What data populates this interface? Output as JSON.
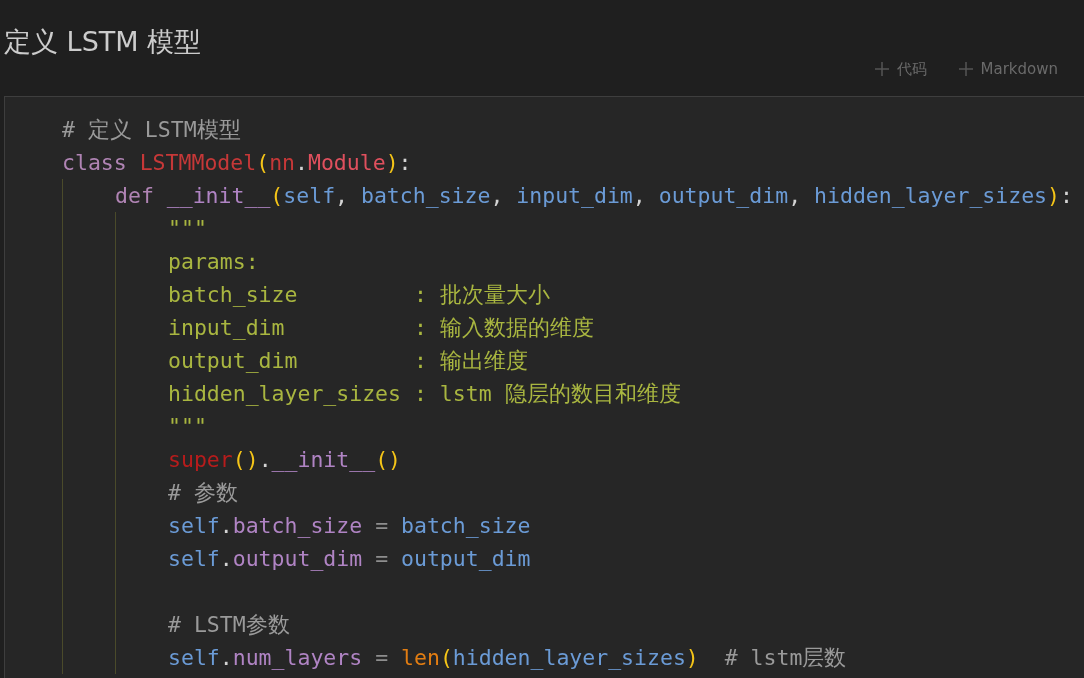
{
  "heading": "定义 LSTM 模型",
  "toolbar": [
    {
      "label": "代码"
    },
    {
      "label": "Markdown"
    }
  ],
  "code": [
    {
      "kind": "code",
      "tokens": [
        {
          "kind": "comment",
          "text": "# 定义 LSTM模型"
        }
      ]
    },
    {
      "kind": "code",
      "tokens": [
        {
          "kind": "keyword",
          "text": "class "
        },
        {
          "kind": "classname",
          "text": "LSTMModel"
        },
        {
          "kind": "paren",
          "text": "("
        },
        {
          "kind": "classname",
          "text": "nn"
        },
        {
          "kind": "plain",
          "text": "."
        },
        {
          "kind": "type",
          "text": "Module"
        },
        {
          "kind": "paren",
          "text": ")"
        },
        {
          "kind": "plain",
          "text": ":"
        }
      ],
      "children": [
        {
          "kind": "code",
          "tokens": [
            {
              "kind": "keyword",
              "text": "def "
            },
            {
              "kind": "dunder",
              "text": "__init__"
            },
            {
              "kind": "paren",
              "text": "("
            },
            {
              "kind": "param",
              "text": "self"
            },
            {
              "kind": "plain",
              "text": ", "
            },
            {
              "kind": "param",
              "text": "batch_size"
            },
            {
              "kind": "plain",
              "text": ", "
            },
            {
              "kind": "param",
              "text": "input_dim"
            },
            {
              "kind": "plain",
              "text": ", "
            },
            {
              "kind": "param",
              "text": "output_dim"
            },
            {
              "kind": "plain",
              "text": ", "
            },
            {
              "kind": "param",
              "text": "hidden_layer_sizes"
            },
            {
              "kind": "paren",
              "text": ")"
            },
            {
              "kind": "plain",
              "text": ":"
            }
          ],
          "children": [
            {
              "kind": "code",
              "tokens": [
                {
                  "kind": "string",
                  "text": "\"\"\""
                }
              ]
            },
            {
              "kind": "code",
              "tokens": [
                {
                  "kind": "string",
                  "text": "params:"
                }
              ]
            },
            {
              "kind": "code",
              "tokens": [
                {
                  "kind": "string",
                  "text": "batch_size         : 批次量大小"
                }
              ]
            },
            {
              "kind": "code",
              "tokens": [
                {
                  "kind": "string",
                  "text": "input_dim          : 输入数据的维度"
                }
              ]
            },
            {
              "kind": "code",
              "tokens": [
                {
                  "kind": "string",
                  "text": "output_dim         : 输出维度"
                }
              ]
            },
            {
              "kind": "code",
              "tokens": [
                {
                  "kind": "string",
                  "text": "hidden_layer_sizes : lstm 隐层的数目和维度"
                }
              ]
            },
            {
              "kind": "code",
              "tokens": [
                {
                  "kind": "string",
                  "text": "\"\"\""
                }
              ]
            },
            {
              "kind": "code",
              "tokens": [
                {
                  "kind": "builtin",
                  "text": "super"
                },
                {
                  "kind": "paren",
                  "text": "()"
                },
                {
                  "kind": "plain",
                  "text": "."
                },
                {
                  "kind": "dunder",
                  "text": "__init__"
                },
                {
                  "kind": "paren",
                  "text": "()"
                }
              ]
            },
            {
              "kind": "code",
              "tokens": [
                {
                  "kind": "comment",
                  "text": "# 参数"
                }
              ]
            },
            {
              "kind": "code",
              "tokens": [
                {
                  "kind": "param",
                  "text": "self"
                },
                {
                  "kind": "plain",
                  "text": "."
                },
                {
                  "kind": "property",
                  "text": "batch_size"
                },
                {
                  "kind": "operator",
                  "text": " = "
                },
                {
                  "kind": "param",
                  "text": "batch_size"
                }
              ]
            },
            {
              "kind": "code",
              "tokens": [
                {
                  "kind": "param",
                  "text": "self"
                },
                {
                  "kind": "plain",
                  "text": "."
                },
                {
                  "kind": "property",
                  "text": "output_dim"
                },
                {
                  "kind": "operator",
                  "text": " = "
                },
                {
                  "kind": "param",
                  "text": "output_dim"
                }
              ]
            },
            {
              "kind": "blank"
            },
            {
              "kind": "code",
              "tokens": [
                {
                  "kind": "comment",
                  "text": "# LSTM参数"
                }
              ]
            },
            {
              "kind": "code",
              "tokens": [
                {
                  "kind": "param",
                  "text": "self"
                },
                {
                  "kind": "plain",
                  "text": "."
                },
                {
                  "kind": "property",
                  "text": "num_layers"
                },
                {
                  "kind": "operator",
                  "text": " = "
                },
                {
                  "kind": "call",
                  "text": "len"
                },
                {
                  "kind": "paren",
                  "text": "("
                },
                {
                  "kind": "param",
                  "text": "hidden_layer_sizes"
                },
                {
                  "kind": "paren",
                  "text": ")"
                },
                {
                  "kind": "comment",
                  "text": "  # lstm层数"
                }
              ]
            }
          ]
        }
      ]
    }
  ]
}
